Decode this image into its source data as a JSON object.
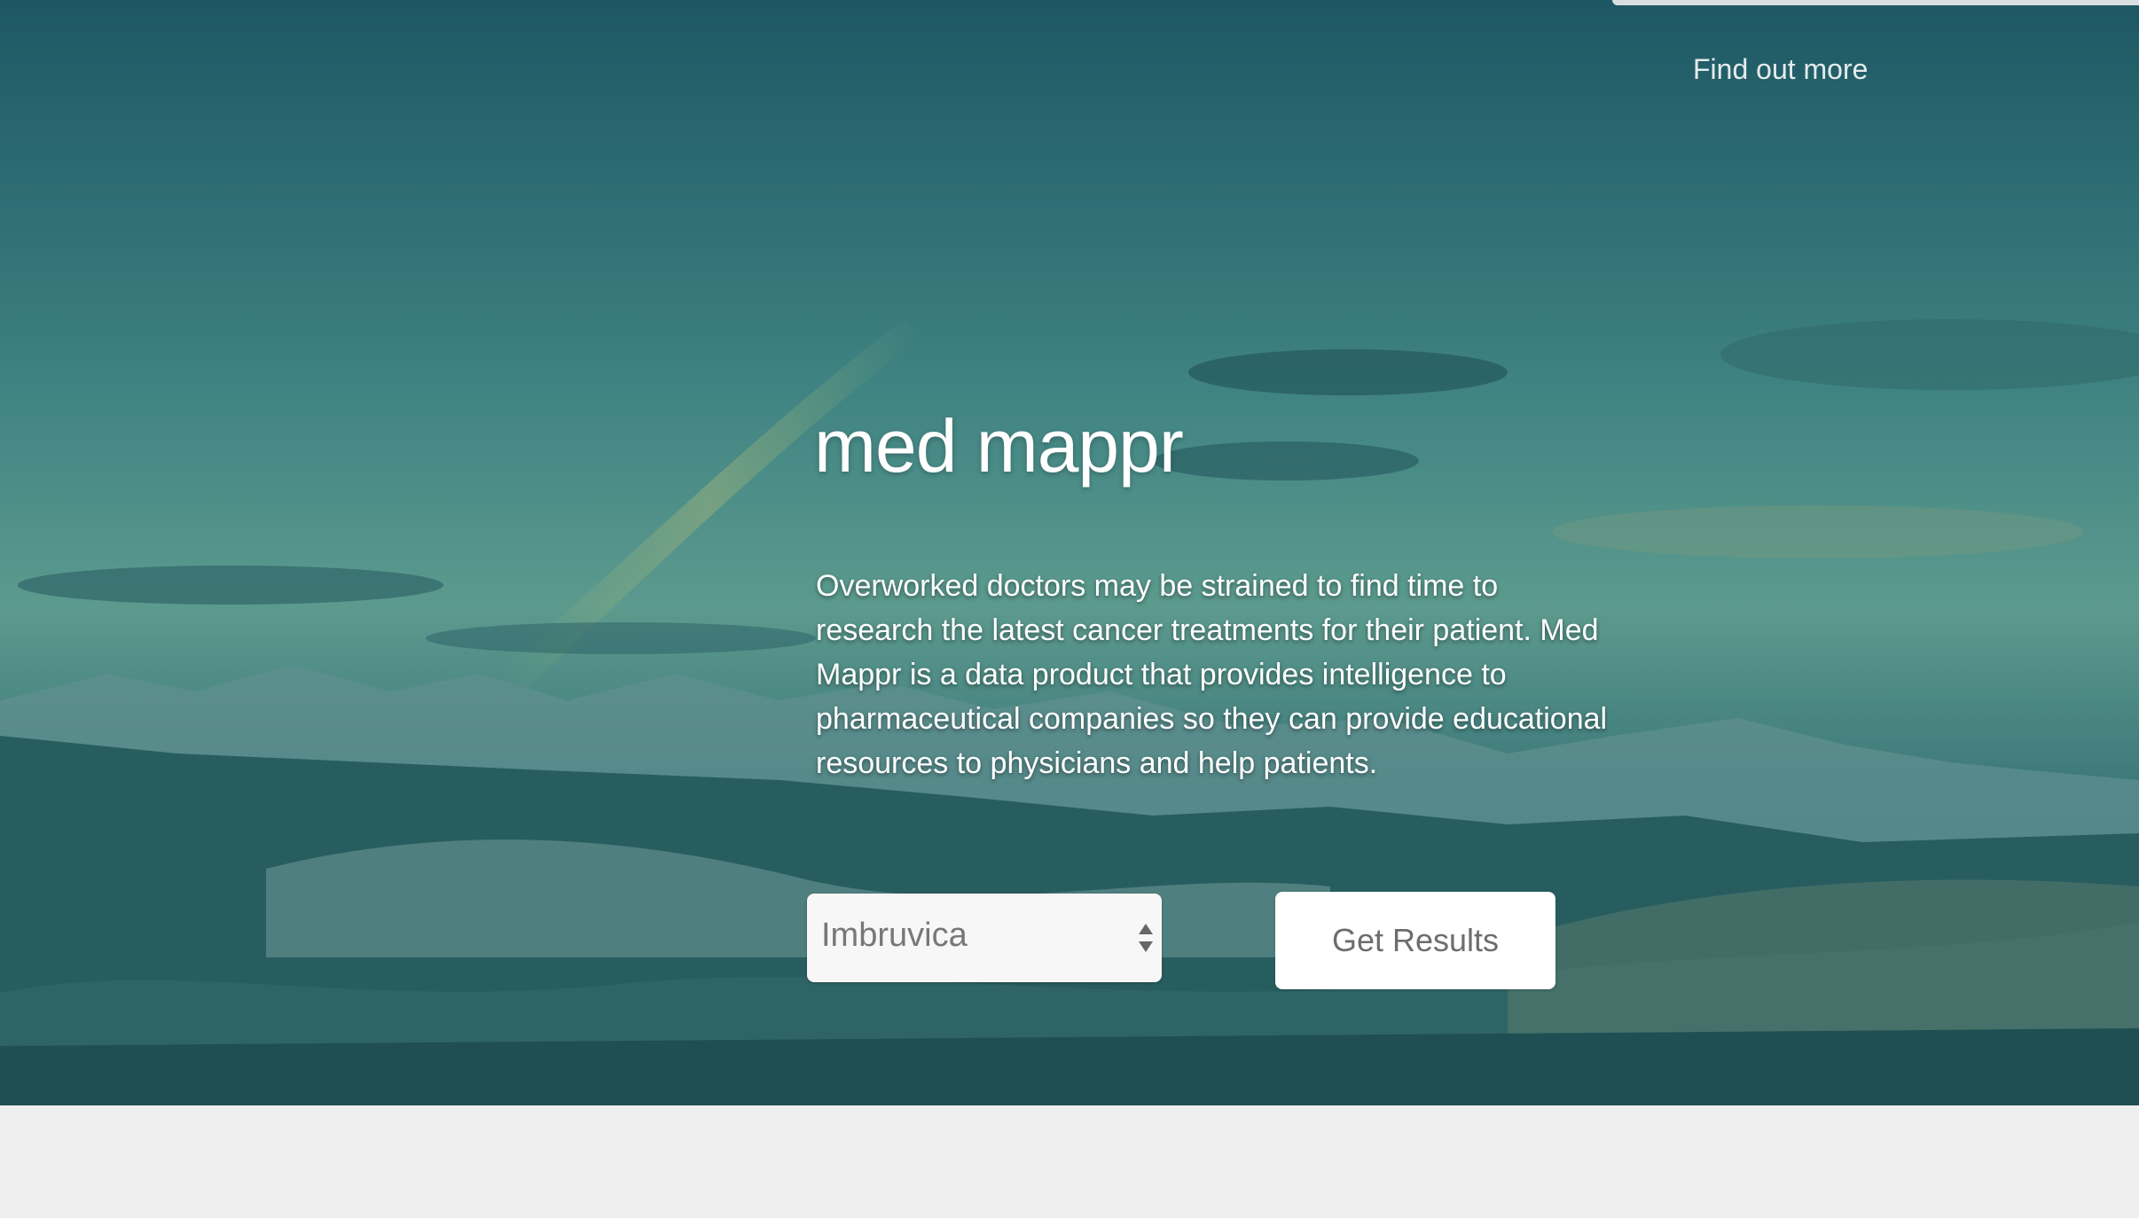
{
  "nav": {
    "find_out_more": "Find out more"
  },
  "hero": {
    "title": "med mappr",
    "description": "Overworked doctors may be strained to find time to research the latest cancer treatments for their patient. Med Mappr is a data product that provides intelligence to pharmaceutical companies so they can provide educational resources to physicians and help patients."
  },
  "form": {
    "drug_select": {
      "selected": "Imbruvica",
      "icon": "select-arrows-icon"
    },
    "submit_label": "Get Results"
  },
  "colors": {
    "overlay_teal": "#2c6f76",
    "footer_bg": "#efefef",
    "button_bg": "#ffffff",
    "button_text": "#6d6d6d"
  }
}
